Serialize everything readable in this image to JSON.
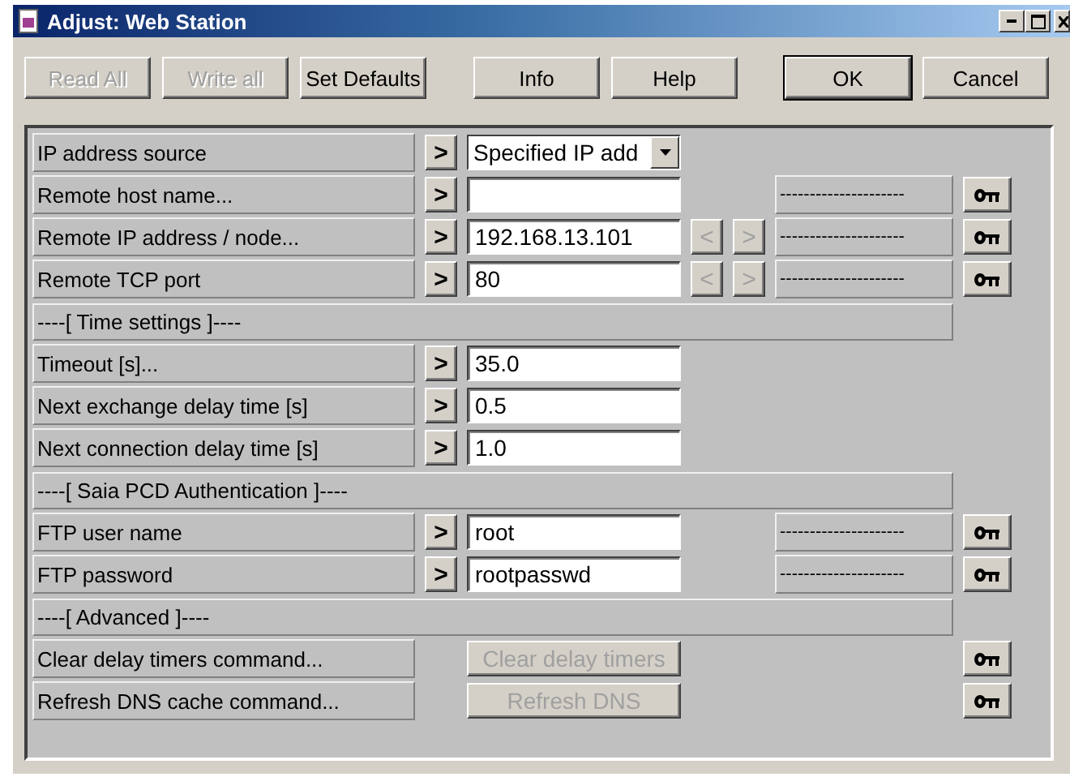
{
  "window": {
    "title": "Adjust: Web Station"
  },
  "toolbar": [
    {
      "buttons": [
        {
          "label": "Read All",
          "disabled": true,
          "default": false
        },
        {
          "label": "Write all",
          "disabled": true,
          "default": false
        },
        {
          "label": "Set Defaults",
          "disabled": false,
          "default": false
        }
      ]
    },
    {
      "buttons": [
        {
          "label": "Info",
          "disabled": false,
          "default": false
        },
        {
          "label": "Help",
          "disabled": false,
          "default": false
        }
      ]
    },
    {
      "buttons": [
        {
          "label": "OK",
          "disabled": false,
          "default": true
        },
        {
          "label": "Cancel",
          "disabled": false,
          "default": false
        }
      ]
    }
  ],
  "rows": [
    {
      "kind": "setting",
      "label": "IP address source",
      "action": ">",
      "input": {
        "kind": "dropdown",
        "value": "Specified IP add"
      },
      "key": false
    },
    {
      "kind": "setting",
      "label": "Remote host name...",
      "action": ">",
      "input": {
        "kind": "text"
      },
      "status": "---------------------",
      "key": true
    },
    {
      "kind": "setting",
      "label": "Remote IP address / node...",
      "action": ">",
      "input": {
        "kind": "text",
        "value": "192.168.13.101"
      },
      "nav": [
        {
          "label": "<",
          "disabled": true
        },
        {
          "label": ">",
          "disabled": true
        }
      ],
      "status": "---------------------",
      "key": true
    },
    {
      "kind": "setting",
      "label": "Remote TCP port",
      "action": ">",
      "input": {
        "kind": "text",
        "value": "80"
      },
      "nav": [
        {
          "label": "<",
          "disabled": true
        },
        {
          "label": ">",
          "disabled": true
        }
      ],
      "status": "---------------------",
      "key": true
    },
    {
      "kind": "section",
      "label": "----[ Time settings ]----"
    },
    {
      "kind": "setting",
      "label": "Timeout [s]...",
      "action": ">",
      "input": {
        "kind": "text",
        "value": "35.0"
      },
      "key": false
    },
    {
      "kind": "setting",
      "label": "Next exchange delay time [s]",
      "action": ">",
      "input": {
        "kind": "text",
        "value": "0.5"
      },
      "key": false
    },
    {
      "kind": "setting",
      "label": "Next connection delay time [s]",
      "action": ">",
      "input": {
        "kind": "text",
        "value": "1.0"
      },
      "key": false
    },
    {
      "kind": "section",
      "label": "----[ Saia PCD Authentication ]----"
    },
    {
      "kind": "setting",
      "label": "FTP user name",
      "action": ">",
      "input": {
        "kind": "text",
        "value": "root"
      },
      "status": "---------------------",
      "key": true
    },
    {
      "kind": "setting",
      "label": "FTP password",
      "action": ">",
      "input": {
        "kind": "text",
        "value": "rootpasswd"
      },
      "status": "---------------------",
      "key": true
    },
    {
      "kind": "section",
      "label": "----[ Advanced ]----"
    },
    {
      "kind": "command",
      "label": "Clear delay timers command...",
      "command": {
        "label": "Clear delay timers",
        "disabled": true
      },
      "key": true
    },
    {
      "kind": "command",
      "label": "Refresh DNS cache command...",
      "command": {
        "label": "Refresh DNS",
        "disabled": true
      },
      "key": true
    }
  ]
}
